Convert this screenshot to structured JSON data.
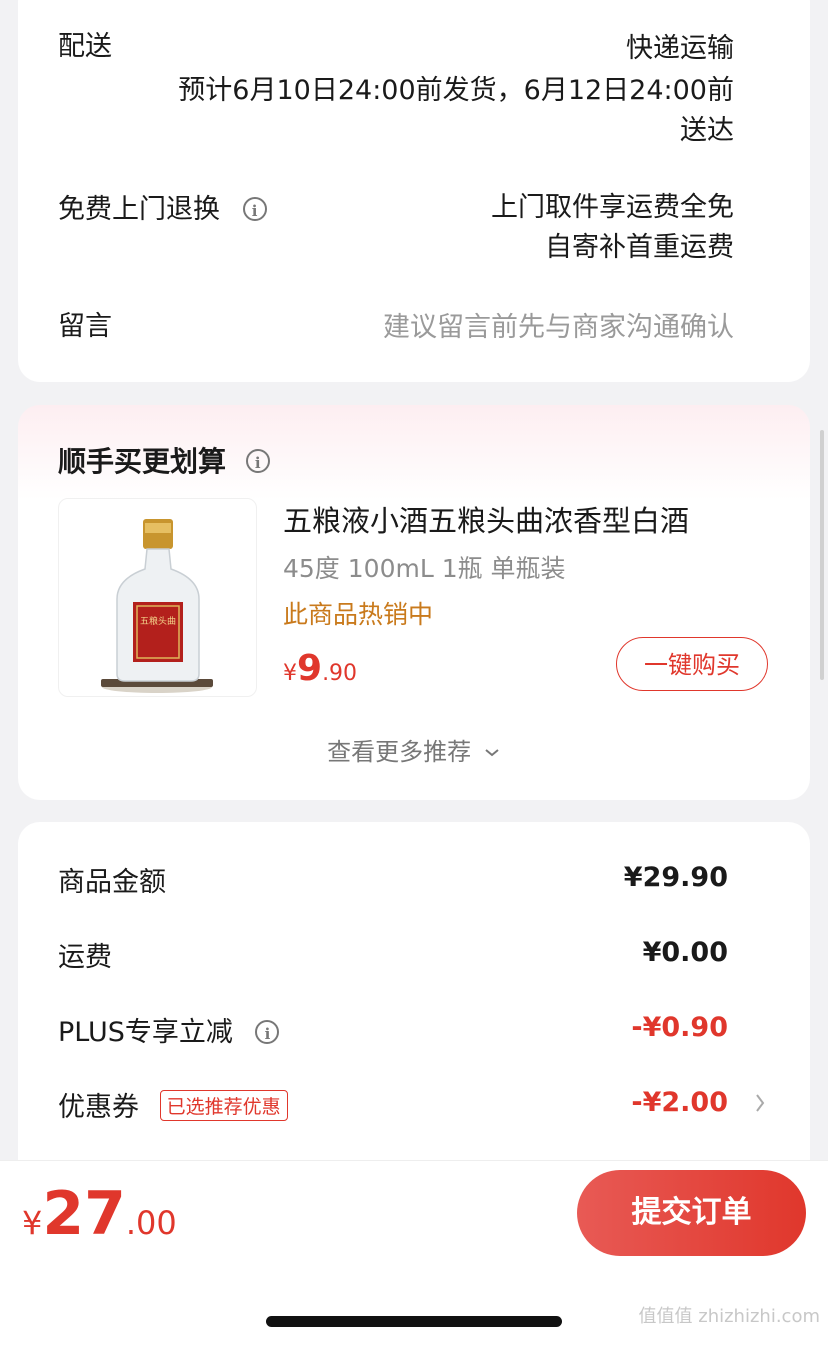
{
  "delivery": {
    "label": "配送",
    "method": "快递运输",
    "estimate_line1": "预计6月10日24:00前发货，6月12日24:00前",
    "estimate_line2": "送达"
  },
  "return": {
    "label": "免费上门退换",
    "line1": "上门取件享运费全免",
    "line2": "自寄补首重运费"
  },
  "message": {
    "label": "留言",
    "placeholder": "建议留言前先与商家沟通确认"
  },
  "recommend": {
    "title": "顺手买更划算",
    "product": {
      "name": "五粮液小酒五粮头曲浓香型白酒",
      "spec": "45度 100mL 1瓶 单瓶装",
      "tag": "此商品热销中",
      "currency": "¥",
      "price_int": "9",
      "price_dec": ".90",
      "label_text": "五粮头曲",
      "buy_button": "一键购买"
    },
    "more": "查看更多推荐"
  },
  "summary": {
    "items": [
      {
        "label": "商品金额",
        "value": "¥29.90"
      },
      {
        "label": "运费",
        "value": "¥0.00"
      },
      {
        "label": "PLUS专享立减",
        "value": "-¥0.90"
      },
      {
        "label": "优惠券",
        "badge": "已选推荐优惠",
        "value": "-¥2.00"
      }
    ]
  },
  "footer": {
    "currency": "¥",
    "total_int": "27",
    "total_dec": ".00",
    "submit": "提交订单"
  },
  "watermark": "值值值 zhizhizhi.com",
  "colors": {
    "accent": "#e0372c",
    "orange": "#c97a1c",
    "gray": "#8c8c8c"
  }
}
